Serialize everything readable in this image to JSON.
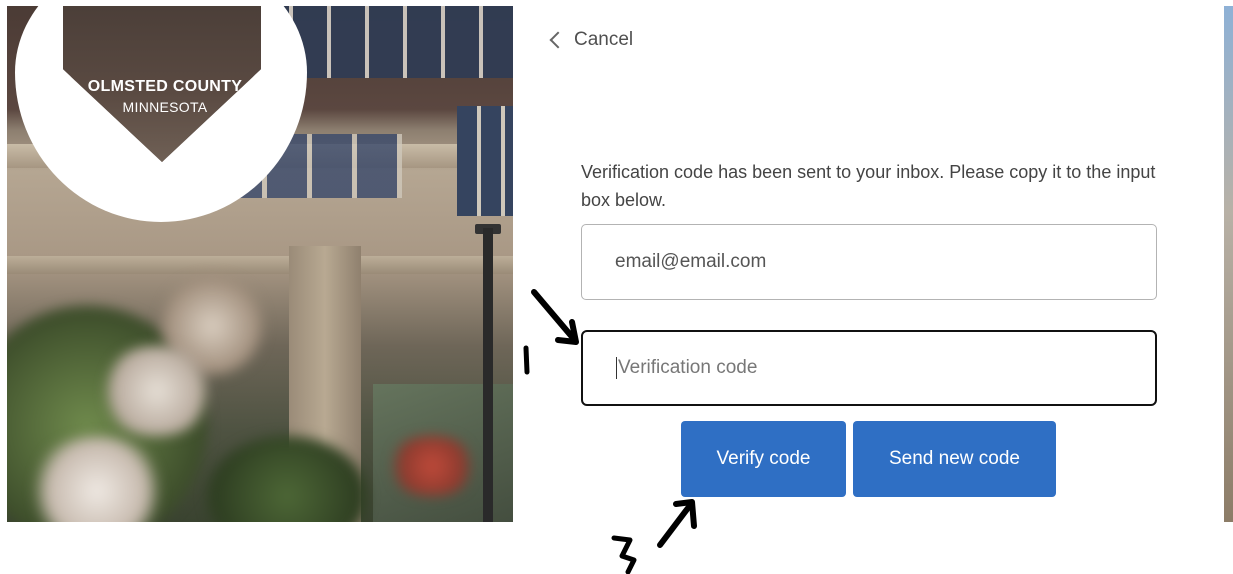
{
  "logo": {
    "line1": "OLMSTED COUNTY",
    "line2": "MINNESOTA"
  },
  "nav": {
    "cancel_label": "Cancel"
  },
  "form": {
    "message": "Verification code has been sent to your inbox. Please copy it to the input box below.",
    "email_value": "email@email.com",
    "code_placeholder": "Verification code",
    "verify_label": "Verify code",
    "send_label": "Send new code"
  },
  "annotations": {
    "step1": "1",
    "step2": "2"
  },
  "colors": {
    "button": "#2f6fc4",
    "text": "#444444"
  }
}
